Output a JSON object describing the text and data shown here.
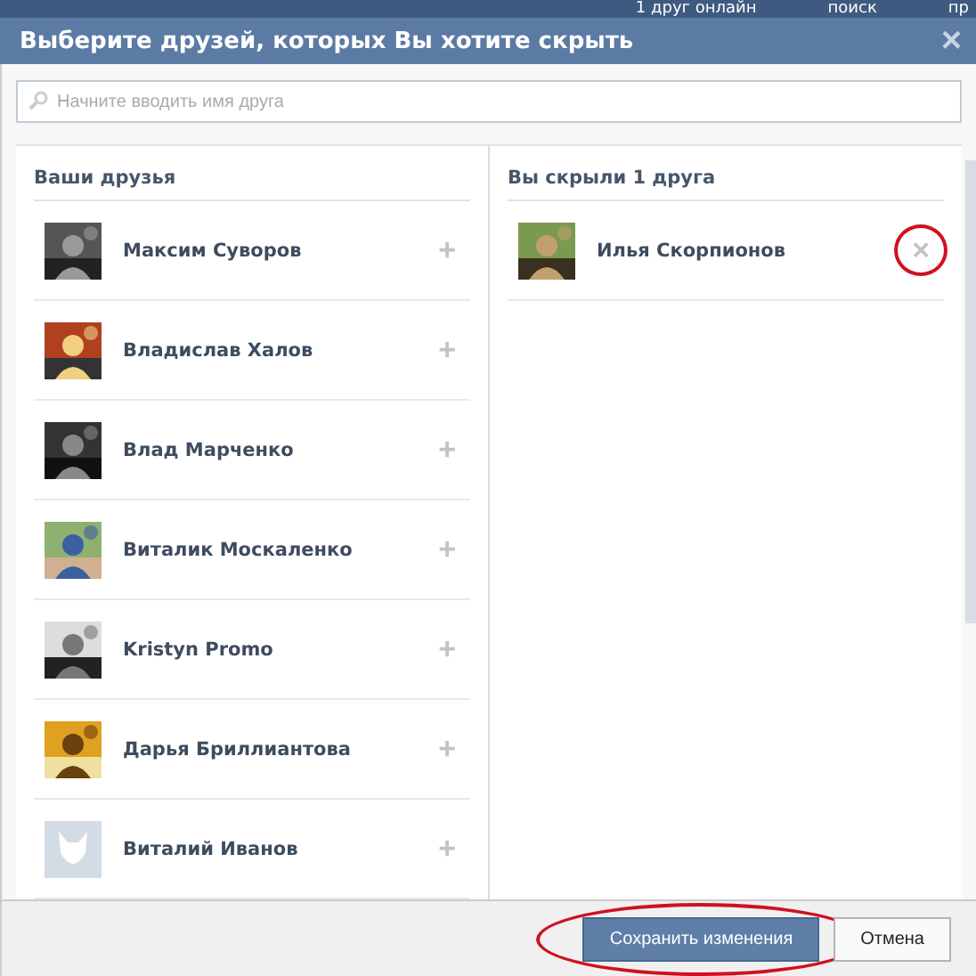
{
  "top_bar": {
    "links": [
      "1 друг онлайн",
      "поиск",
      "пр"
    ]
  },
  "dialog": {
    "title": "Выберите друзей, которых Вы хотите скрыть",
    "close": "×"
  },
  "search": {
    "placeholder": "Начните вводить имя друга"
  },
  "friends": {
    "heading": "Ваши друзья",
    "items": [
      {
        "name": "Максим Суворов",
        "action": "+"
      },
      {
        "name": "Владислав Халов",
        "action": "+"
      },
      {
        "name": "Влад Марченко",
        "action": "+"
      },
      {
        "name": "Виталик Москаленко",
        "action": "+"
      },
      {
        "name": "Kristyn Promo",
        "action": "+"
      },
      {
        "name": "Дарья Бриллиантова",
        "action": "+"
      },
      {
        "name": "Виталий Иванов",
        "kind": "default",
        "action": "+"
      }
    ]
  },
  "hidden": {
    "heading": "Вы скрыли 1 друга",
    "items": [
      {
        "name": "Илья Скорпионов",
        "action": "×",
        "circled": true
      }
    ]
  },
  "footer": {
    "buttons": [
      {
        "label": "Сохранить изменения",
        "kind": "primary",
        "circled": true
      },
      {
        "label": "Отмена",
        "kind": "secondary",
        "circled": false
      }
    ]
  }
}
